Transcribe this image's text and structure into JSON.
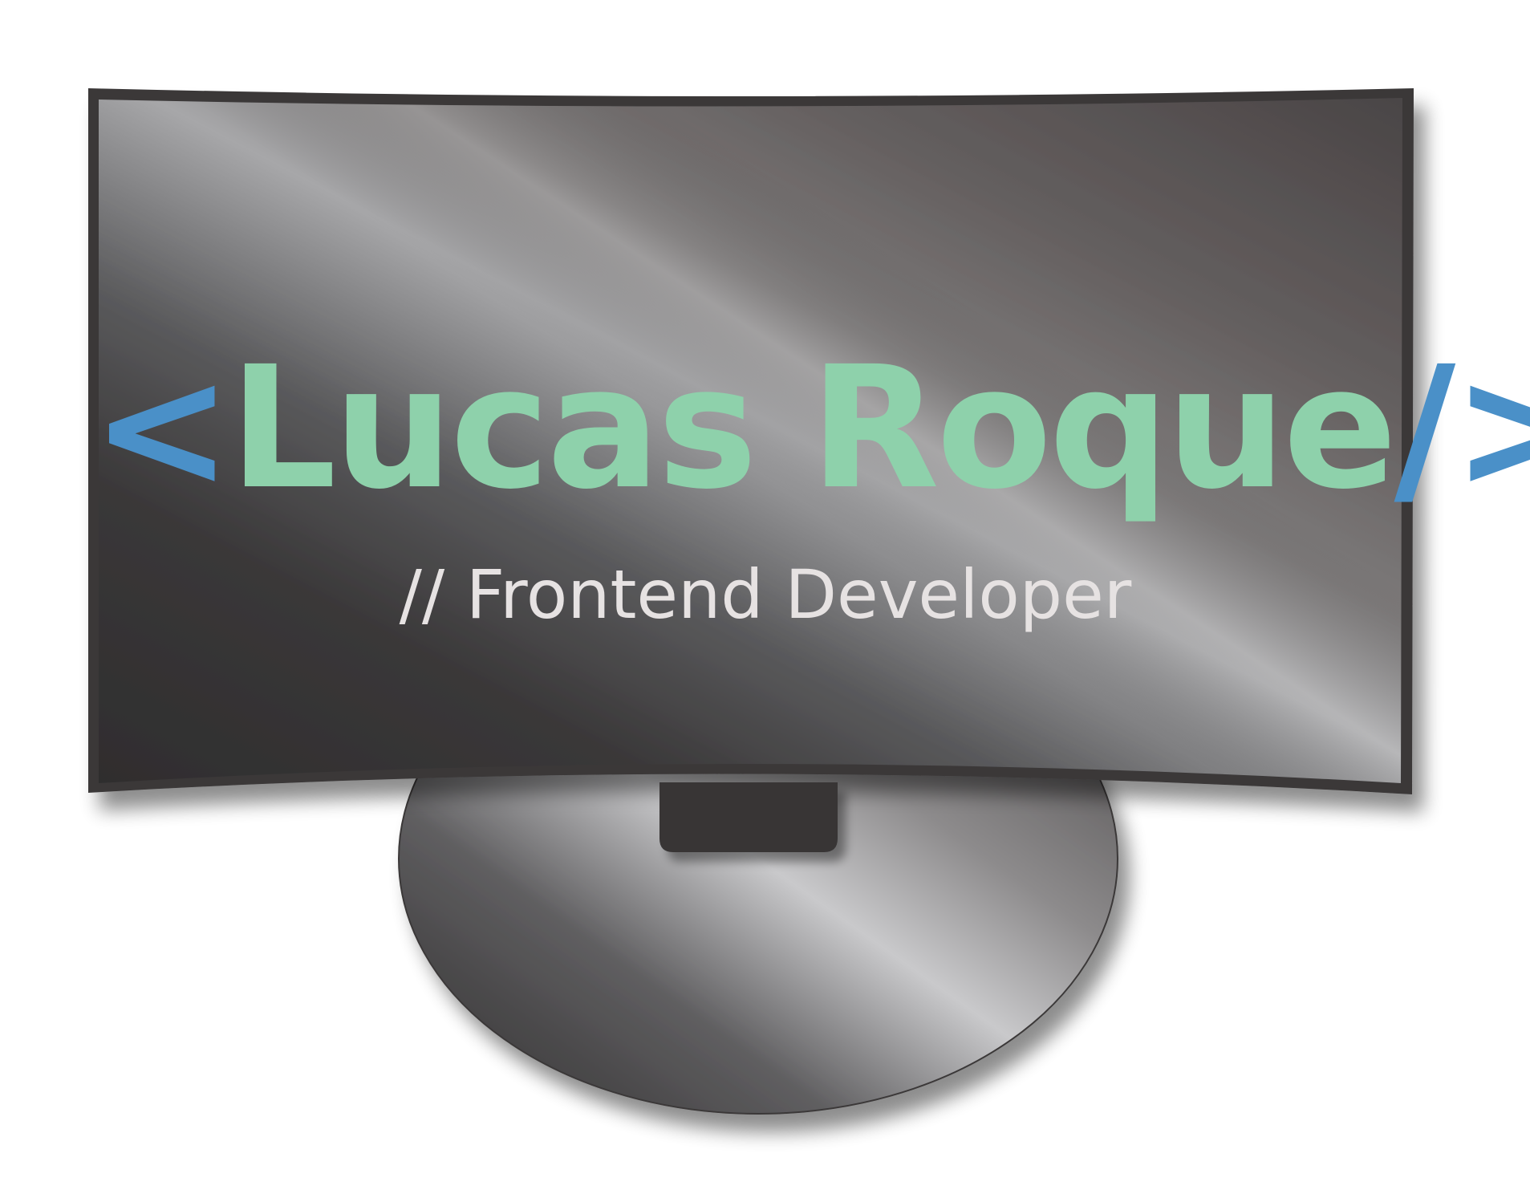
{
  "logo": {
    "open_bracket": "<",
    "name": "Lucas Roque",
    "slash": "/",
    "close_bracket": ">",
    "subtitle": "// Frontend Developer"
  },
  "colors": {
    "background": "#ffffff",
    "bezel": "#3a3839",
    "name_text": "#8ed1ab",
    "bracket_blue": "#4a90c8",
    "subtitle_text": "#e6e2e2",
    "screen_light": "#a9a9ab",
    "screen_dark": "#373536"
  },
  "icons": {
    "monitor": "monitor-icon"
  }
}
